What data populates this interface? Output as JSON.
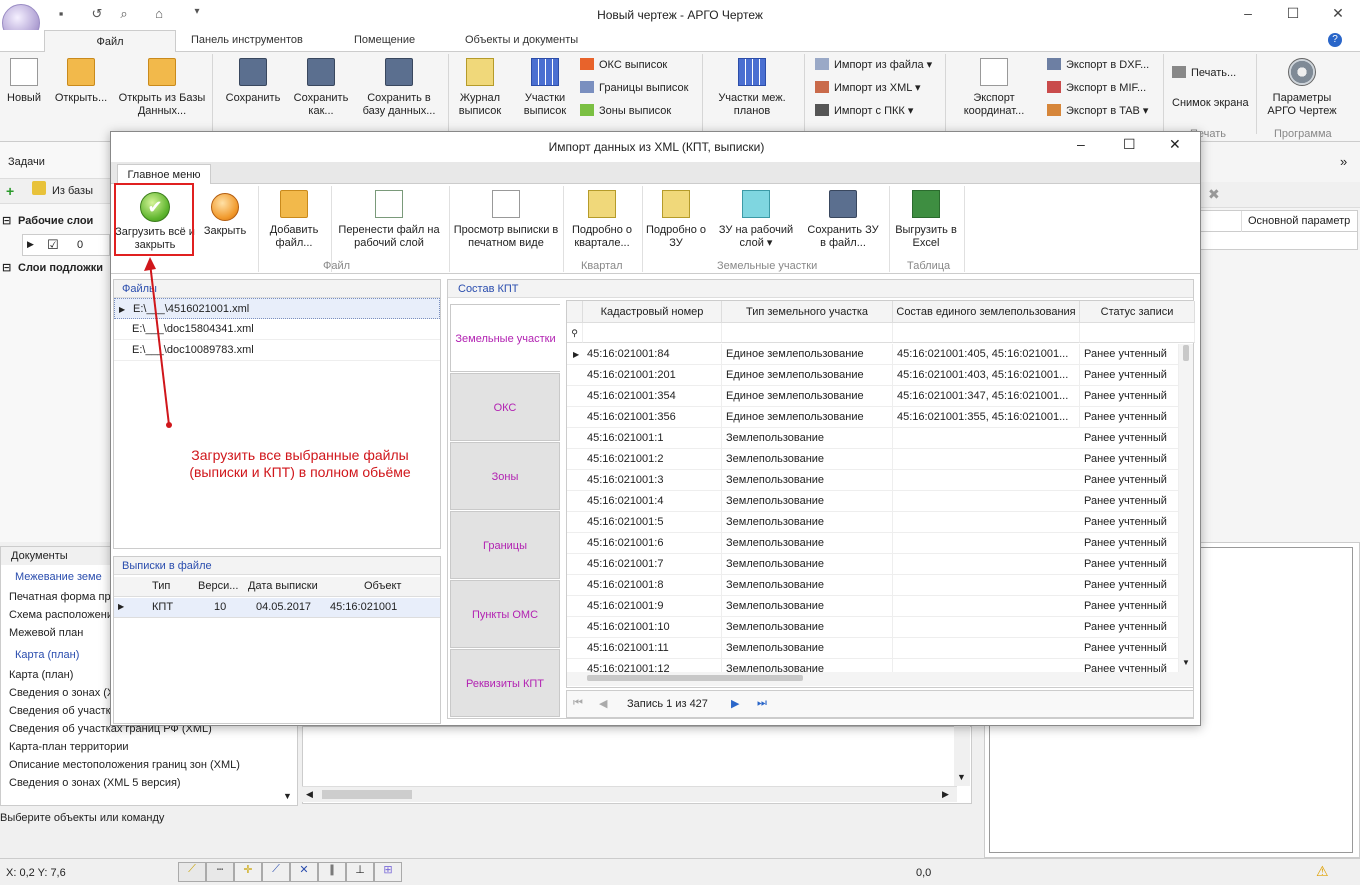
{
  "app": {
    "title": "Новый чертеж - АРГО Чертеж"
  },
  "ribbon_tabs": [
    "Файл",
    "Панель инструментов",
    "Помещение",
    "Объекты и документы"
  ],
  "ribbon": {
    "new": "Новый",
    "open": "Открыть...",
    "open_db": "Открыть из Базы Данных...",
    "save": "Сохранить",
    "save_as": "Сохранить как...",
    "save_db": "Сохранить в базу данных...",
    "journal": "Журнал выписок",
    "plots": "Участки выписок",
    "oks": "ОКС выписок",
    "borders": "Границы выписок",
    "zones": "Зоны выписок",
    "interplots": "Участки меж. планов",
    "import_file": "Импорт из файла",
    "import_xml": "Импорт из XML",
    "import_pkk": "Импорт с ПКК",
    "export_coords": "Экспорт координат...",
    "export_dxf": "Экспорт в DXF...",
    "export_mif": "Экспорт в MIF...",
    "export_tab": "Экспорт в TAB",
    "print": "Печать...",
    "screenshot": "Снимок экрана",
    "params": "Параметры АРГО Чертеж",
    "group_print": "Печать",
    "group_program": "Программа"
  },
  "left": {
    "tasks": "Задачи",
    "from_db": "Из базы",
    "work_layers": "Рабочие слои",
    "layer_count": "0",
    "base_layers": "Слои подложки",
    "docs_header": "Документы",
    "docs": [
      "Межевание земе",
      "Печатная форма пр",
      "Схема расположени",
      "Межевой план",
      "Карта (план)",
      "Карта (план)",
      "Сведения о зонах (X",
      "Сведения об участк",
      "Сведения об участках границ РФ (XML)",
      "Карта-план территории",
      "Описание местоположения границ зон (XML)",
      "Сведения о зонах (XML 5 версия)"
    ],
    "status_hint": "Выберите объекты или команду"
  },
  "dialog": {
    "title": "Импорт данных из XML (КПТ, выписки)",
    "tab_main": "Главное меню",
    "btn_load_all": "Загрузить всё и закрыть",
    "btn_close": "Закрыть",
    "btn_add_file": "Добавить файл...",
    "btn_move_file": "Перенести файл на рабочий слой",
    "btn_preview": "Просмотр выписки в печатном виде",
    "btn_detail_quarter": "Подробно о квартале...",
    "btn_detail_zu": "Подробно о ЗУ",
    "btn_zu_to_layer": "ЗУ на рабочий слой",
    "btn_save_zu": "Сохранить ЗУ в файл...",
    "btn_export_excel": "Выгрузить в Excel",
    "group_file": "Файл",
    "group_quarter": "Квартал",
    "group_land": "Земельные участки",
    "group_table": "Таблица",
    "files_header": "Файлы",
    "files": [
      "E:\\___\\4516021001.xml",
      "E:\\___\\doc15804341.xml",
      "E:\\___\\doc10089783.xml"
    ],
    "extracts_header": "Выписки в файле",
    "extracts_cols": [
      "Тип",
      "Верси...",
      "Дата выписки",
      "Объект"
    ],
    "extracts_row": [
      "КПТ",
      "10",
      "04.05.2017",
      "45:16:021001"
    ],
    "kpt_header": "Состав КПТ",
    "vtabs": [
      "Земельные участки",
      "ОКС",
      "Зоны",
      "Границы",
      "Пункты ОМС",
      "Реквизиты КПТ"
    ],
    "grid_cols": [
      "Кадастровый номер",
      "Тип земельного участка",
      "Состав единого землепользования",
      "Статус записи"
    ],
    "grid_rows": [
      [
        "45:16:021001:84",
        "Единое землепользование",
        "45:16:021001:405, 45:16:021001...",
        "Ранее учтенный"
      ],
      [
        "45:16:021001:201",
        "Единое землепользование",
        "45:16:021001:403, 45:16:021001...",
        "Ранее учтенный"
      ],
      [
        "45:16:021001:354",
        "Единое землепользование",
        "45:16:021001:347, 45:16:021001...",
        "Ранее учтенный"
      ],
      [
        "45:16:021001:356",
        "Единое землепользование",
        "45:16:021001:355, 45:16:021001...",
        "Ранее учтенный"
      ],
      [
        "45:16:021001:1",
        "Землепользование",
        "",
        "Ранее учтенный"
      ],
      [
        "45:16:021001:2",
        "Землепользование",
        "",
        "Ранее учтенный"
      ],
      [
        "45:16:021001:3",
        "Землепользование",
        "",
        "Ранее учтенный"
      ],
      [
        "45:16:021001:4",
        "Землепользование",
        "",
        "Ранее учтенный"
      ],
      [
        "45:16:021001:5",
        "Землепользование",
        "",
        "Ранее учтенный"
      ],
      [
        "45:16:021001:6",
        "Землепользование",
        "",
        "Ранее учтенный"
      ],
      [
        "45:16:021001:7",
        "Землепользование",
        "",
        "Ранее учтенный"
      ],
      [
        "45:16:021001:8",
        "Землепользование",
        "",
        "Ранее учтенный"
      ],
      [
        "45:16:021001:9",
        "Землепользование",
        "",
        "Ранее учтенный"
      ],
      [
        "45:16:021001:10",
        "Землепользование",
        "",
        "Ранее учтенный"
      ],
      [
        "45:16:021001:11",
        "Землепользование",
        "",
        "Ранее учтенный"
      ],
      [
        "45:16:021001:12",
        "Землепользование",
        "",
        "Ранее учтенный"
      ]
    ],
    "record_nav": "Запись 1 из 427"
  },
  "annotation": "Загрузить все выбранные файлы (выписки и КПТ) в полном обьёме",
  "right": {
    "main_param": "Основной параметр"
  },
  "status": {
    "coords": "X: 0,2 Y: 7,6",
    "value": "0,0"
  },
  "colors": {
    "accent": "#2a4dae",
    "vtab_text": "#b222b2",
    "annotation": "#d0161b"
  }
}
